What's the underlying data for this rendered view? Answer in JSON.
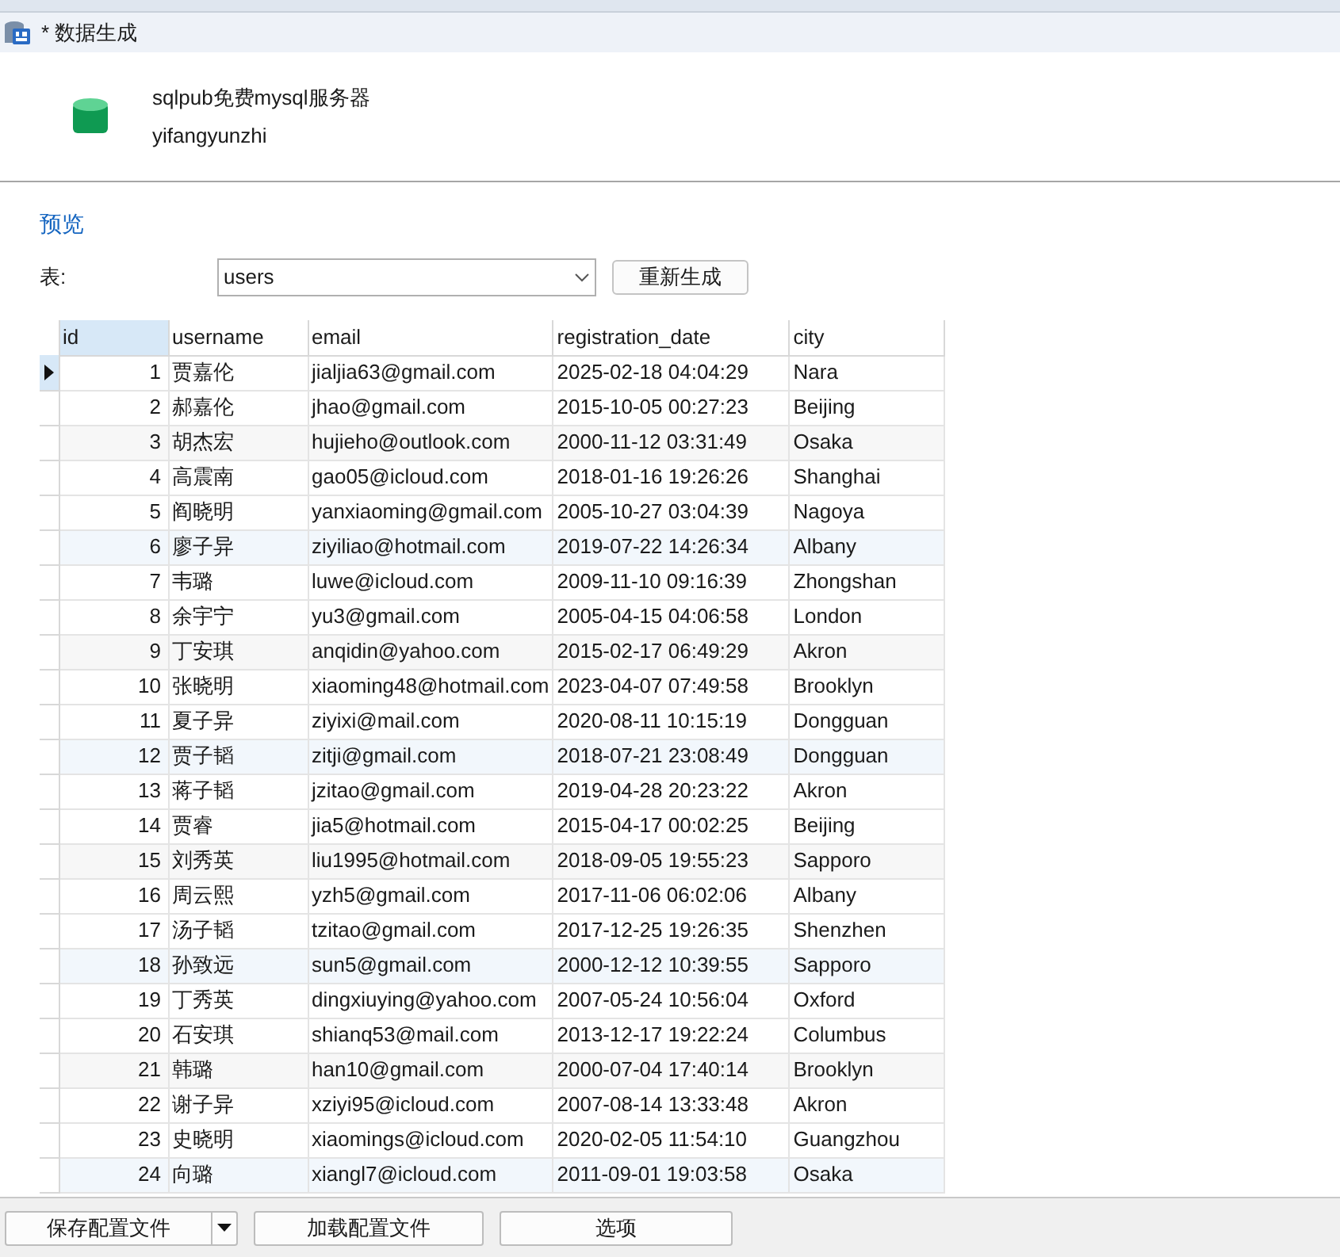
{
  "window": {
    "title": "* 数据生成"
  },
  "connection": {
    "name": "sqlpub免费mysql服务器",
    "database": "yifangyunzhi"
  },
  "preview": {
    "heading": "预览",
    "table_label": "表:",
    "table_select": {
      "value": "users"
    },
    "regenerate_button": "重新生成"
  },
  "table": {
    "columns": [
      {
        "label": "id",
        "selected": true
      },
      {
        "label": "username",
        "selected": false
      },
      {
        "label": "email",
        "selected": false
      },
      {
        "label": "registration_date",
        "selected": false
      },
      {
        "label": "city",
        "selected": false
      }
    ],
    "rows": [
      {
        "current": true,
        "cells": [
          "1",
          "贾嘉伦",
          "jialjia63@gmail.com",
          "2025-02-18 04:04:29",
          "Nara"
        ]
      },
      {
        "current": false,
        "cells": [
          "2",
          "郝嘉伦",
          "jhao@gmail.com",
          "2015-10-05 00:27:23",
          "Beijing"
        ]
      },
      {
        "current": false,
        "cells": [
          "3",
          "胡杰宏",
          "hujieho@outlook.com",
          "2000-11-12 03:31:49",
          "Osaka"
        ]
      },
      {
        "current": false,
        "cells": [
          "4",
          "高震南",
          "gao05@icloud.com",
          "2018-01-16 19:26:26",
          "Shanghai"
        ]
      },
      {
        "current": false,
        "cells": [
          "5",
          "阎晓明",
          "yanxiaoming@gmail.com",
          "2005-10-27 03:04:39",
          "Nagoya"
        ]
      },
      {
        "current": false,
        "cells": [
          "6",
          "廖子异",
          "ziyiliao@hotmail.com",
          "2019-07-22 14:26:34",
          "Albany"
        ]
      },
      {
        "current": false,
        "cells": [
          "7",
          "韦璐",
          "luwe@icloud.com",
          "2009-11-10 09:16:39",
          "Zhongshan"
        ]
      },
      {
        "current": false,
        "cells": [
          "8",
          "余宇宁",
          "yu3@gmail.com",
          "2005-04-15 04:06:58",
          "London"
        ]
      },
      {
        "current": false,
        "cells": [
          "9",
          "丁安琪",
          "anqidin@yahoo.com",
          "2015-02-17 06:49:29",
          "Akron"
        ]
      },
      {
        "current": false,
        "cells": [
          "10",
          "张晓明",
          "xiaoming48@hotmail.com",
          "2023-04-07 07:49:58",
          "Brooklyn"
        ]
      },
      {
        "current": false,
        "cells": [
          "11",
          "夏子异",
          "ziyixi@mail.com",
          "2020-08-11 10:15:19",
          "Dongguan"
        ]
      },
      {
        "current": false,
        "cells": [
          "12",
          "贾子韬",
          "zitji@gmail.com",
          "2018-07-21 23:08:49",
          "Dongguan"
        ]
      },
      {
        "current": false,
        "cells": [
          "13",
          "蒋子韬",
          "jzitao@gmail.com",
          "2019-04-28 20:23:22",
          "Akron"
        ]
      },
      {
        "current": false,
        "cells": [
          "14",
          "贾睿",
          "jia5@hotmail.com",
          "2015-04-17 00:02:25",
          "Beijing"
        ]
      },
      {
        "current": false,
        "cells": [
          "15",
          "刘秀英",
          "liu1995@hotmail.com",
          "2018-09-05 19:55:23",
          "Sapporo"
        ]
      },
      {
        "current": false,
        "cells": [
          "16",
          "周云熙",
          "yzh5@gmail.com",
          "2017-11-06 06:02:06",
          "Albany"
        ]
      },
      {
        "current": false,
        "cells": [
          "17",
          "汤子韬",
          "tzitao@gmail.com",
          "2017-12-25 19:26:35",
          "Shenzhen"
        ]
      },
      {
        "current": false,
        "cells": [
          "18",
          "孙致远",
          "sun5@gmail.com",
          "2000-12-12 10:39:55",
          "Sapporo"
        ]
      },
      {
        "current": false,
        "cells": [
          "19",
          "丁秀英",
          "dingxiuying@yahoo.com",
          "2007-05-24 10:56:04",
          "Oxford"
        ]
      },
      {
        "current": false,
        "cells": [
          "20",
          "石安琪",
          "shianq53@mail.com",
          "2013-12-17 19:22:24",
          "Columbus"
        ]
      },
      {
        "current": false,
        "cells": [
          "21",
          "韩璐",
          "han10@gmail.com",
          "2000-07-04 17:40:14",
          "Brooklyn"
        ]
      },
      {
        "current": false,
        "cells": [
          "22",
          "谢子异",
          "xziyi95@icloud.com",
          "2007-08-14 13:33:48",
          "Akron"
        ]
      },
      {
        "current": false,
        "cells": [
          "23",
          "史晓明",
          "xiaomings@icloud.com",
          "2020-02-05 11:54:10",
          "Guangzhou"
        ]
      },
      {
        "current": false,
        "cells": [
          "24",
          "向璐",
          "xiangl7@icloud.com",
          "2011-09-01 19:03:58",
          "Osaka"
        ]
      }
    ]
  },
  "footer_buttons": [
    {
      "kind": "split",
      "label": "保存配置文件"
    },
    {
      "kind": "plain",
      "label": "加载配置文件"
    },
    {
      "kind": "plain",
      "label": "选项"
    }
  ]
}
